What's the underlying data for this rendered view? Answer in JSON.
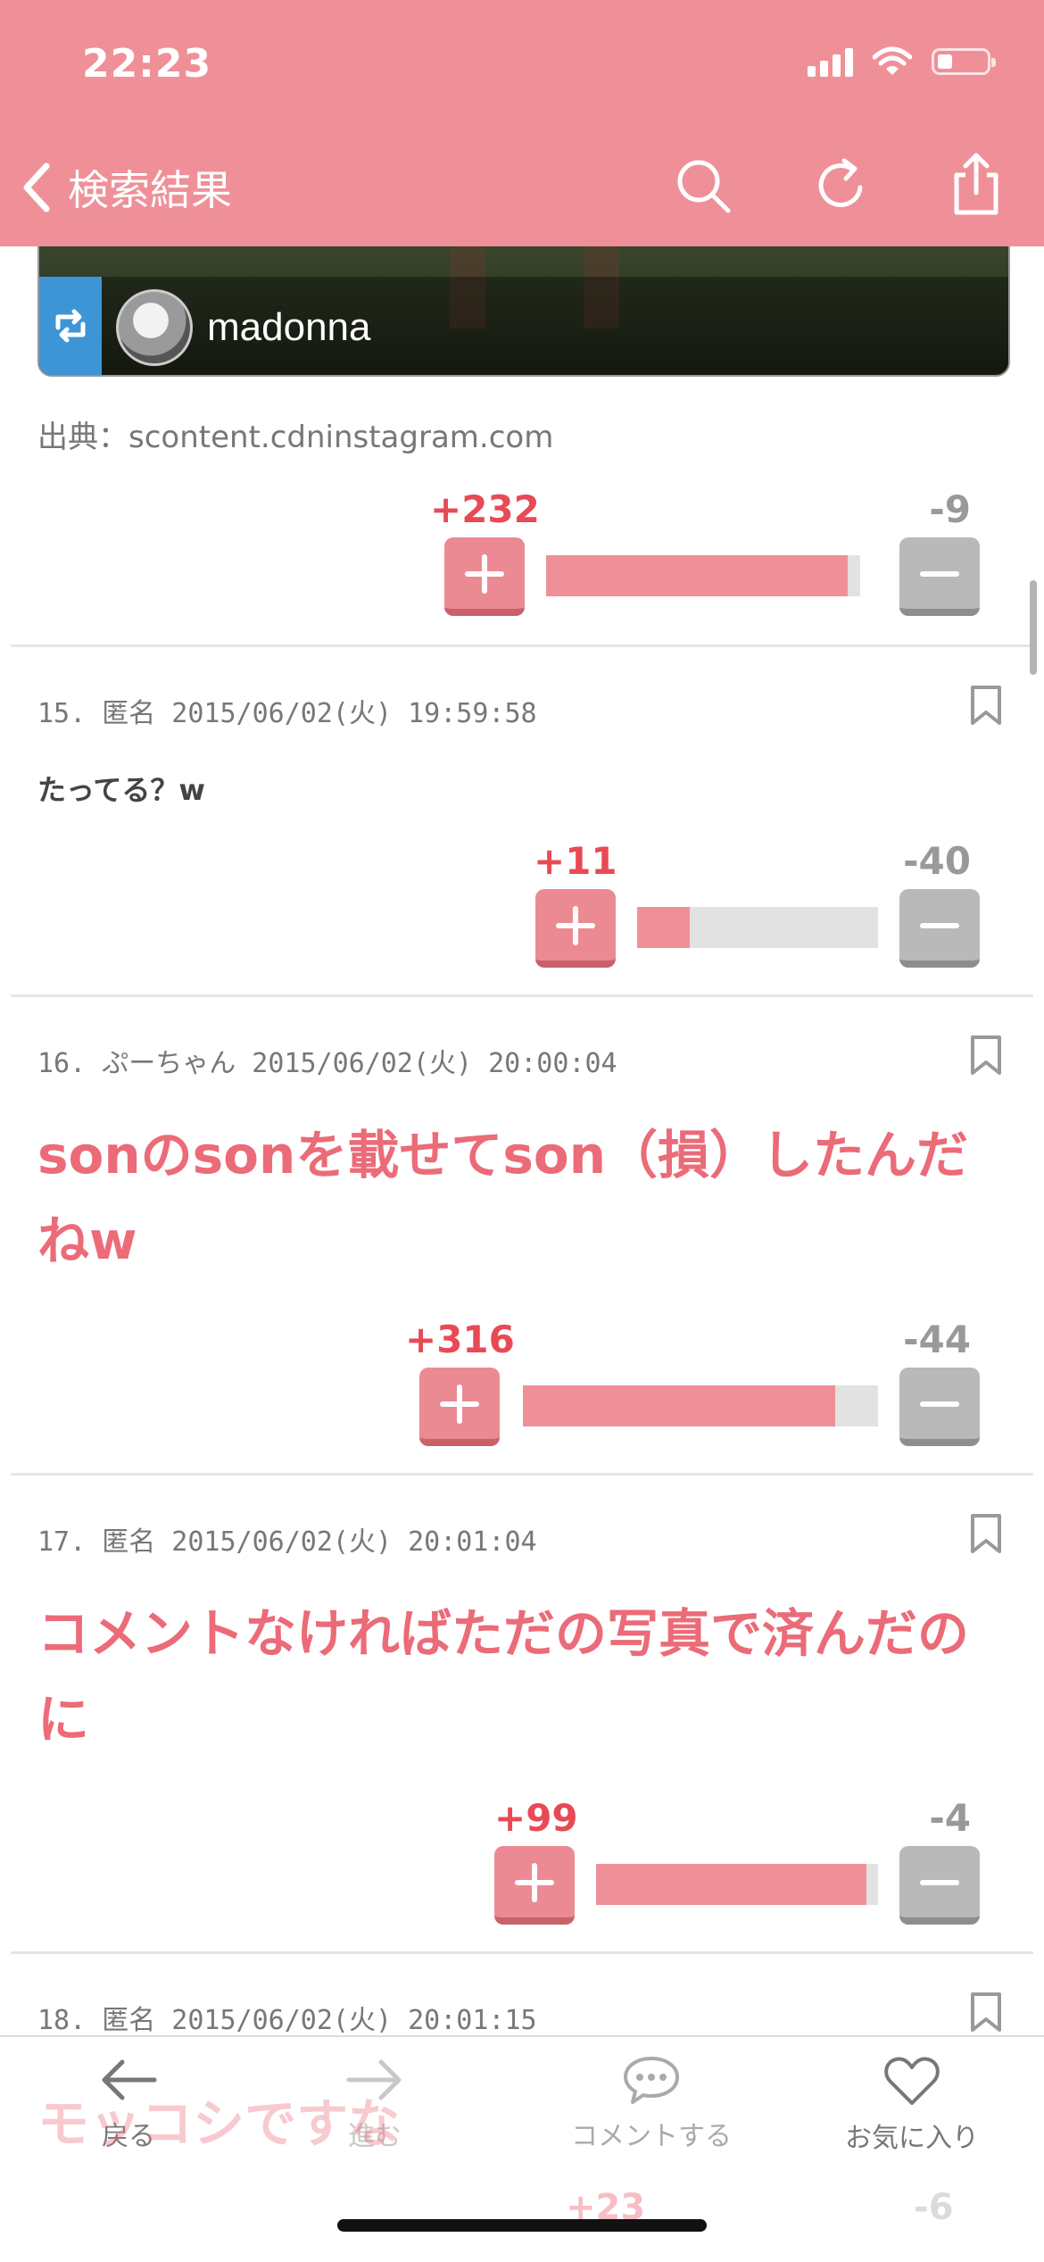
{
  "status_bar": {
    "time": "22:23"
  },
  "nav": {
    "back_label": "検索結果"
  },
  "post14": {
    "instagram_user": "madonna",
    "source": "出典：scontent.cdninstagram.com",
    "plus": "+232",
    "minus": "-9",
    "ratio": 0.96
  },
  "comments": [
    {
      "meta": "15. 匿名 2015/06/02(火) 19:59:58",
      "text": "たってる？w",
      "plus": "+11",
      "minus": "-40",
      "ratio": 0.22
    },
    {
      "meta": "16. ぷーちゃん 2015/06/02(火) 20:00:04",
      "text": "sonのsonを載せてson（損）したんだねw",
      "plus": "+316",
      "minus": "-44",
      "ratio": 0.88
    },
    {
      "meta": "17. 匿名 2015/06/02(火) 20:01:04",
      "text": "コメントなければただの写真で済んだのに",
      "plus": "+99",
      "minus": "-4",
      "ratio": 0.96
    },
    {
      "meta": "18. 匿名 2015/06/02(火) 20:01:15",
      "text": "モッコシですな",
      "plus": "+23",
      "minus": "-6"
    }
  ],
  "tabbar": {
    "back": "戻る",
    "forward": "進む",
    "comment": "コメントする",
    "favorite": "お気に入り"
  },
  "colors": {
    "header": "#ef9099",
    "accent_text": "#eb6b78",
    "plus_count": "#e84a55"
  }
}
